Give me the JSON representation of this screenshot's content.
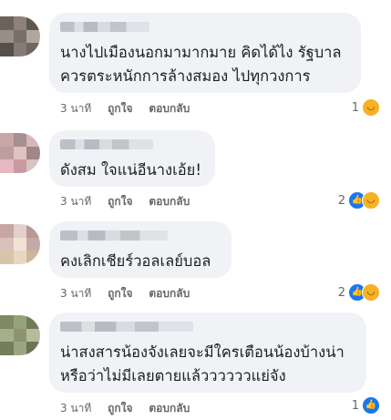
{
  "comments": [
    {
      "lines": [
        "นางไปเมืองนอกมามากมาย  คิดได้ไง รัฐบาล",
        "ควรตระหนักการล้างสมอง ไปทุกวงการ"
      ],
      "time": "3 นาที",
      "like_label": "ถูกใจ",
      "reply_label": "ตอบกลับ",
      "reaction_count": "1",
      "reactions": [
        "haha-icon"
      ]
    },
    {
      "lines": [
        "ดังสม ใจแน่อีนางเอ้ย!"
      ],
      "time": "3 นาที",
      "like_label": "ถูกใจ",
      "reply_label": "ตอบกลับ",
      "reaction_count": "2",
      "reactions": [
        "like-icon",
        "haha-icon"
      ]
    },
    {
      "lines": [
        "คงเลิกเชียร์วอลเลย์บอล"
      ],
      "time": "3 นาที",
      "like_label": "ถูกใจ",
      "reply_label": "ตอบกลับ",
      "reaction_count": "2",
      "reactions": [
        "like-icon",
        "haha-icon"
      ]
    },
    {
      "lines": [
        "น่าสงสารน้องจังเลยจะมีใครเตือนน้องบ้างน่า",
        "หรือว่าไม่มีเลยตายแล้ววววววแย่จัง"
      ],
      "time": "3 นาที",
      "like_label": "ถูกใจ",
      "reply_label": "ตอบกลับ",
      "reaction_count": "1",
      "reactions": [
        "like-icon"
      ]
    }
  ],
  "colors": {
    "bubble": "#f0f2f5",
    "text": "#1c1e21",
    "meta": "#65676b",
    "like": "#1877f2",
    "haha": "#f7b125"
  }
}
